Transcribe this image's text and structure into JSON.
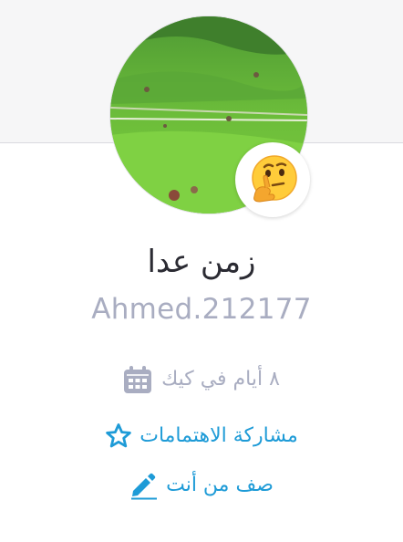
{
  "profile": {
    "name": "زمن عدا",
    "handle": "Ahmed.212177",
    "mood_icon": "thinking-face-emoji",
    "joined": "٨ أيام في كيك",
    "share_interests": "مشاركة الاهتمامات",
    "describe_yourself": "صف من أنت"
  },
  "colors": {
    "accent": "#1e9bd7",
    "muted": "#a9adc1",
    "name": "#2b2b33"
  },
  "icons": {
    "joined": "calendar-icon",
    "interests": "star-icon",
    "describe": "pencil-icon"
  }
}
